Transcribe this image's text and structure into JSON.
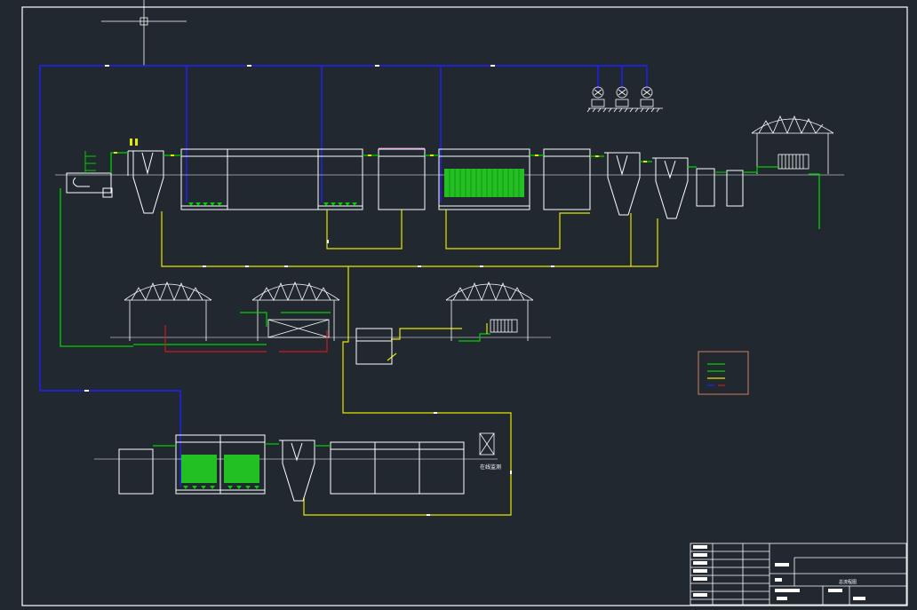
{
  "drawing": {
    "background": "#212830",
    "colors": {
      "frame": "#ffffff",
      "air_pipe": "#2020ff",
      "sludge_pipe": "#e6e600",
      "water_pipe": "#00d000",
      "reflux_pipe": "#d01818",
      "membrane_fill": "#22c022",
      "legend_border": "#d08060"
    },
    "labels": {
      "online_monitor": "在线监测",
      "title_block_name": "总流程图"
    },
    "icons": [
      "blower-icon",
      "blower-icon",
      "blower-icon",
      "filter-press-icon",
      "filter-press-icon"
    ]
  }
}
